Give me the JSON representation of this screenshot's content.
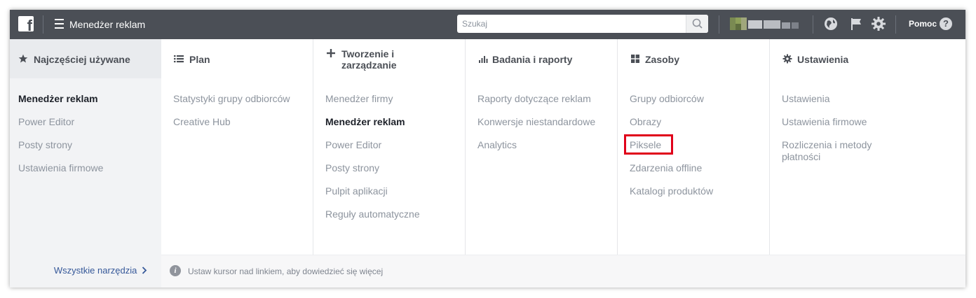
{
  "topbar": {
    "logo_letter": "f",
    "app_title": "Menedżer reklam",
    "search_placeholder": "Szukaj",
    "help_label": "Pomoc",
    "help_icon_glyph": "?",
    "icons": [
      "facebook-logo-icon",
      "hamburger-icon",
      "search-icon",
      "globe-icon",
      "flag-icon",
      "gear-icon",
      "help-icon"
    ]
  },
  "menu": {
    "columns": [
      {
        "icon": "star-icon",
        "title": "Najczęściej używane",
        "items": [
          {
            "label": "Menedżer reklam",
            "active": true
          },
          {
            "label": "Power Editor"
          },
          {
            "label": "Posty strony"
          },
          {
            "label": "Ustawienia firmowe"
          }
        ]
      },
      {
        "icon": "list-icon",
        "title": "Plan",
        "items": [
          {
            "label": "Statystyki grupy odbiorców"
          },
          {
            "label": "Creative Hub"
          }
        ]
      },
      {
        "icon": "plus-icon",
        "title_line1": "Tworzenie i",
        "title_line2": "zarządzanie",
        "items": [
          {
            "label": "Menedżer firmy"
          },
          {
            "label": "Menedżer reklam",
            "active": true
          },
          {
            "label": "Power Editor"
          },
          {
            "label": "Posty strony"
          },
          {
            "label": "Pulpit aplikacji"
          },
          {
            "label": "Reguły automatyczne"
          }
        ]
      },
      {
        "icon": "bar-chart-icon",
        "title": "Badania i raporty",
        "items": [
          {
            "label": "Raporty dotyczące reklam"
          },
          {
            "label": "Konwersje niestandardowe"
          },
          {
            "label": "Analytics"
          }
        ]
      },
      {
        "icon": "grid-icon",
        "title": "Zasoby",
        "items": [
          {
            "label": "Grupy odbiorców"
          },
          {
            "label": "Obrazy"
          },
          {
            "label": "Piksele",
            "highlighted": true
          },
          {
            "label": "Zdarzenia offline"
          },
          {
            "label": "Katalogi produktów"
          }
        ]
      },
      {
        "icon": "gear-icon",
        "title": "Ustawienia",
        "items": [
          {
            "label": "Ustawienia"
          },
          {
            "label": "Ustawienia firmowe"
          },
          {
            "label": "Rozliczenia i metody płatności"
          }
        ]
      }
    ]
  },
  "footer": {
    "all_tools_label": "Wszystkie narzędzia",
    "info_icon_glyph": "i",
    "hint": "Ustaw kursor nad linkiem, aby dowiedzieć się więcej"
  },
  "colors": {
    "topbar": "#4b4f56",
    "highlight": "#e0001a",
    "link": "#365899"
  }
}
